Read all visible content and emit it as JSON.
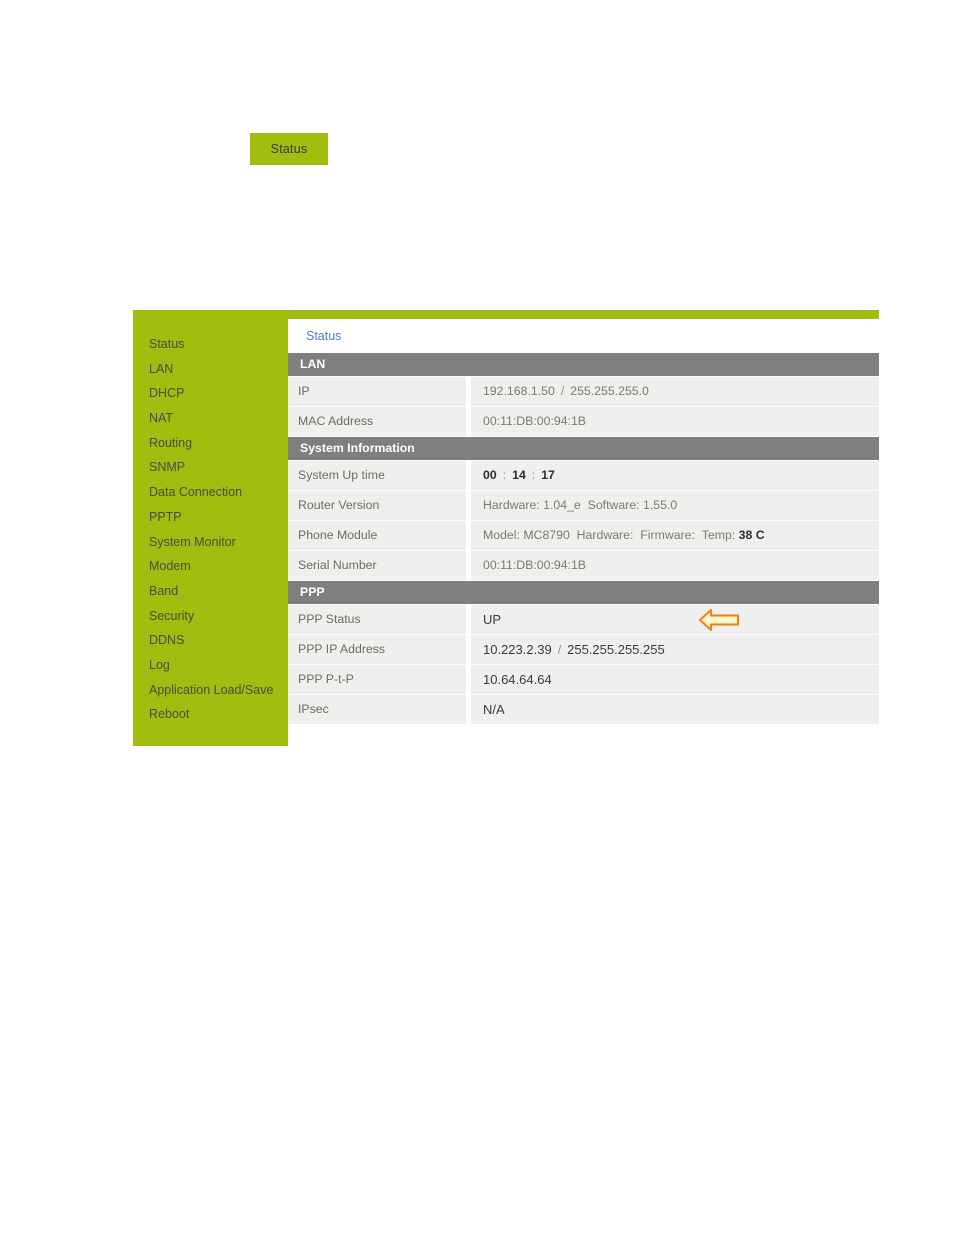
{
  "doc": {
    "button_label": "Status"
  },
  "panel": {
    "breadcrumb": "Status",
    "accent_green": "#A2BC10",
    "header_gray": "#7F7F7F",
    "row_bg": "#EFEFED",
    "link_blue": "#4A7EBB"
  },
  "sidebar": {
    "items": [
      {
        "label": "Status"
      },
      {
        "label": "LAN"
      },
      {
        "label": "DHCP"
      },
      {
        "label": "NAT"
      },
      {
        "label": "Routing"
      },
      {
        "label": "SNMP"
      },
      {
        "label": "Data Connection"
      },
      {
        "label": "PPTP"
      },
      {
        "label": "System Monitor"
      },
      {
        "label": "Modem"
      },
      {
        "label": "Band"
      },
      {
        "label": "Security"
      },
      {
        "label": "DDNS"
      },
      {
        "label": "Log"
      },
      {
        "label": "Application Load/Save"
      },
      {
        "label": "Reboot"
      }
    ]
  },
  "sections": {
    "lan": {
      "title": "LAN",
      "rows": [
        {
          "label": "IP",
          "ip": "192.168.1.50",
          "sep": "/",
          "mask": "255.255.255.0"
        },
        {
          "label": "MAC Address",
          "value": "00:11:DB:00:94:1B"
        }
      ]
    },
    "system_information": {
      "title": "System Information",
      "uptime": {
        "label": "System Up time",
        "hours": "00",
        "minutes": "14",
        "seconds": "17",
        "colon": ":"
      },
      "router_version": {
        "label": "Router Version",
        "hardware_key": "Hardware:",
        "hardware_value": "1.04_e",
        "software_key": "Software:",
        "software_value": "1.55.0"
      },
      "phone_module": {
        "label": "Phone Module",
        "model_key": "Model:",
        "model_value": "MC8790",
        "hardware_key": "Hardware:",
        "hardware_value": "",
        "firmware_key": "Firmware:",
        "firmware_value": "",
        "temp_key": "Temp:",
        "temp_value": "38 C"
      },
      "serial_number": {
        "label": "Serial Number",
        "value": "00:11:DB:00:94:1B"
      }
    },
    "ppp": {
      "title": "PPP",
      "status": {
        "label": "PPP Status",
        "value": "UP"
      },
      "ip_address": {
        "label": "PPP IP Address",
        "ip": "10.223.2.39",
        "sep": "/",
        "mask": "255.255.255.255"
      },
      "ptp": {
        "label": "PPP P-t-P",
        "value": "10.64.64.64"
      },
      "ipsec": {
        "label": "IPsec",
        "value": "N/A"
      }
    }
  },
  "annotation": {
    "arrow_name": "left-arrow-callout",
    "fill": "#FFF6C9",
    "stroke": "#F07F14"
  }
}
